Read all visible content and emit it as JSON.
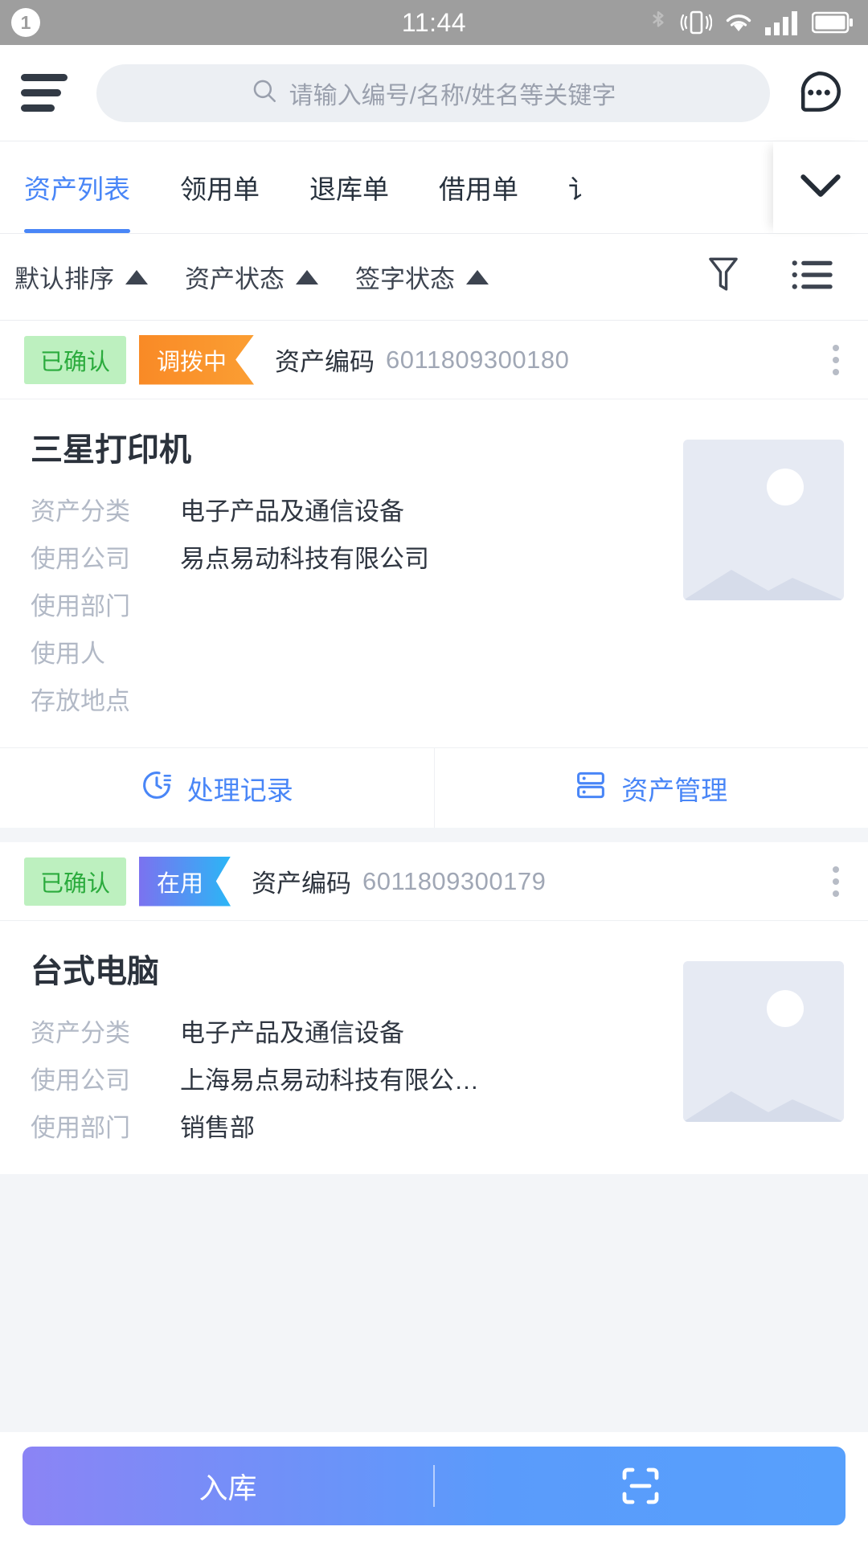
{
  "statusbar": {
    "notification_count": "1",
    "time": "11:44",
    "icons": [
      "bluetooth-icon",
      "vibrate-icon",
      "wifi-icon",
      "signal-icon",
      "battery-icon"
    ]
  },
  "header": {
    "menu_icon": "hamburger-menu-icon",
    "search": {
      "icon": "search-icon",
      "placeholder": "请输入编号/名称/姓名等关键字",
      "value": ""
    },
    "chat_icon": "chat-dots-icon"
  },
  "tabs": {
    "items": [
      {
        "label": "资产列表",
        "active": true
      },
      {
        "label": "领用单",
        "active": false
      },
      {
        "label": "退库单",
        "active": false
      },
      {
        "label": "借用单",
        "active": false
      },
      {
        "label": "讠",
        "active": false
      }
    ],
    "expand_icon": "chevron-down-icon"
  },
  "filters": {
    "items": [
      {
        "label": "默认排序",
        "arrow": "caret-up-icon"
      },
      {
        "label": "资产状态",
        "arrow": "caret-up-icon"
      },
      {
        "label": "签字状态",
        "arrow": "caret-up-icon"
      }
    ],
    "funnel_icon": "filter-funnel-icon",
    "list_icon": "list-view-icon"
  },
  "cards": [
    {
      "sign_status": "已确认",
      "asset_status": "调拨中",
      "status_color": "#f98a26",
      "code_label": "资产编码",
      "code_value": "6011809300180",
      "menu_icon": "more-vertical-icon",
      "title": "三星打印机",
      "thumbnail": "image-placeholder-icon",
      "fields": [
        {
          "label": "资产分类",
          "value": "电子产品及通信设备"
        },
        {
          "label": "使用公司",
          "value": "易点易动科技有限公司"
        },
        {
          "label": "使用部门",
          "value": ""
        },
        {
          "label": "使用人",
          "value": ""
        },
        {
          "label": "存放地点",
          "value": ""
        }
      ],
      "actions": [
        {
          "label": "处理记录",
          "icon": "history-record-icon"
        },
        {
          "label": "资产管理",
          "icon": "asset-manage-icon"
        }
      ]
    },
    {
      "sign_status": "已确认",
      "asset_status": "在用",
      "status_color": "#4f86f7",
      "code_label": "资产编码",
      "code_value": "6011809300179",
      "menu_icon": "more-vertical-icon",
      "title": "台式电脑",
      "thumbnail": "image-placeholder-icon",
      "fields": [
        {
          "label": "资产分类",
          "value": "电子产品及通信设备"
        },
        {
          "label": "使用公司",
          "value": "上海易点易动科技有限公…"
        },
        {
          "label": "使用部门",
          "value": "销售部"
        }
      ],
      "actions": []
    }
  ],
  "bottombar": {
    "primary_label": "入库",
    "scan_icon": "scan-code-icon"
  },
  "colors": {
    "accent": "#4986f7",
    "confirm_badge_bg": "#bdf0bf",
    "confirm_badge_text": "#2bab3d",
    "status_orange": "#f98a26",
    "status_blue": "#4f86f7"
  }
}
